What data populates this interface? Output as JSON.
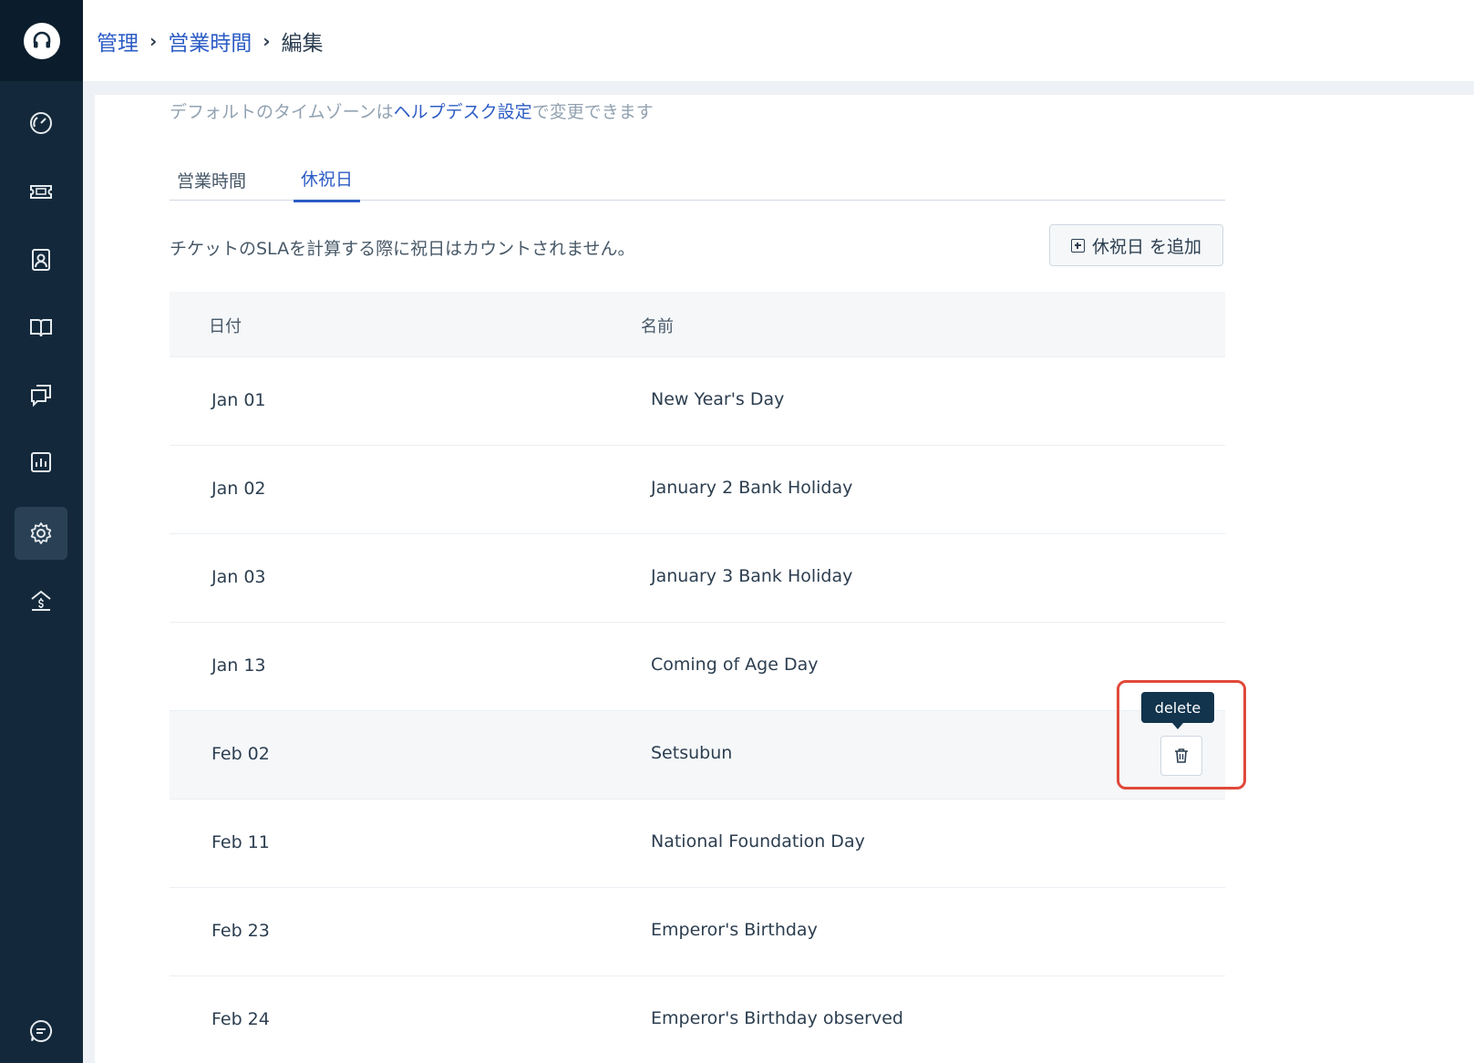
{
  "breadcrumb": [
    {
      "label": "管理",
      "link": true
    },
    {
      "label": "営業時間",
      "link": true
    },
    {
      "label": "編集",
      "link": false
    }
  ],
  "timezone_note": {
    "prefix": "デフォルトのタイムゾーンは",
    "link": "ヘルプデスク設定",
    "suffix": "で変更できます"
  },
  "tabs": [
    {
      "label": "営業時間",
      "active": false
    },
    {
      "label": "休祝日",
      "active": true
    }
  ],
  "sla_note": "チケットのSLAを計算する際に祝日はカウントされません。",
  "add_button_label": "休祝日 を追加",
  "table": {
    "headers": {
      "date": "日付",
      "name": "名前"
    },
    "rows": [
      {
        "date": "Jan 01",
        "name": "New Year's Day"
      },
      {
        "date": "Jan 02",
        "name": "January 2 Bank Holiday"
      },
      {
        "date": "Jan 03",
        "name": "January 3 Bank Holiday"
      },
      {
        "date": "Jan 13",
        "name": "Coming of Age Day"
      },
      {
        "date": "Feb 02",
        "name": "Setsubun"
      },
      {
        "date": "Feb 11",
        "name": "National Foundation Day"
      },
      {
        "date": "Feb 23",
        "name": "Emperor's Birthday"
      },
      {
        "date": "Feb 24",
        "name": "Emperor's Birthday observed"
      }
    ]
  },
  "tooltip": "delete",
  "sidebar_icons": [
    "dashboard-icon",
    "ticket-icon",
    "contact-icon",
    "book-icon",
    "chat-icon",
    "report-icon",
    "gear-icon",
    "upgrade-icon",
    "message-icon"
  ],
  "colors": {
    "sidebar": "#13293b",
    "accent": "#2c5cc5",
    "highlight": "#e0493a",
    "tooltip": "#12344d"
  }
}
